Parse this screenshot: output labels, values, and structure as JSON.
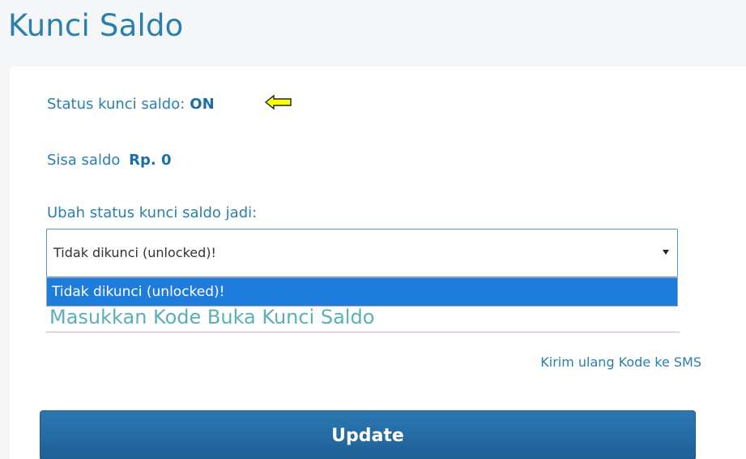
{
  "page": {
    "title": "Kunci Saldo"
  },
  "status": {
    "label": "Status kunci saldo:",
    "value": "ON"
  },
  "saldo": {
    "label": "Sisa saldo",
    "value": "Rp. 0"
  },
  "change_status": {
    "label": "Ubah status kunci saldo jadi:",
    "selected": "Tidak dikunci (unlocked)!",
    "options": [
      "Tidak dikunci (unlocked)!"
    ]
  },
  "code_field": {
    "placeholder": "Masukkan Kode Buka Kunci Saldo",
    "value": ""
  },
  "resend_link": {
    "label": "Kirim ulang Kode ke SMS"
  },
  "actions": {
    "update_label": "Update"
  },
  "annotation": {
    "arrow_icon": "left-arrow-icon",
    "arrow_color": "#ffff00"
  },
  "colors": {
    "primary_text": "#2a7fae",
    "button_bg": "#2c78b3",
    "dropdown_highlight": "#1e7ddc",
    "input_underline": "#f1a7b3",
    "placeholder": "#5ab0b7"
  }
}
